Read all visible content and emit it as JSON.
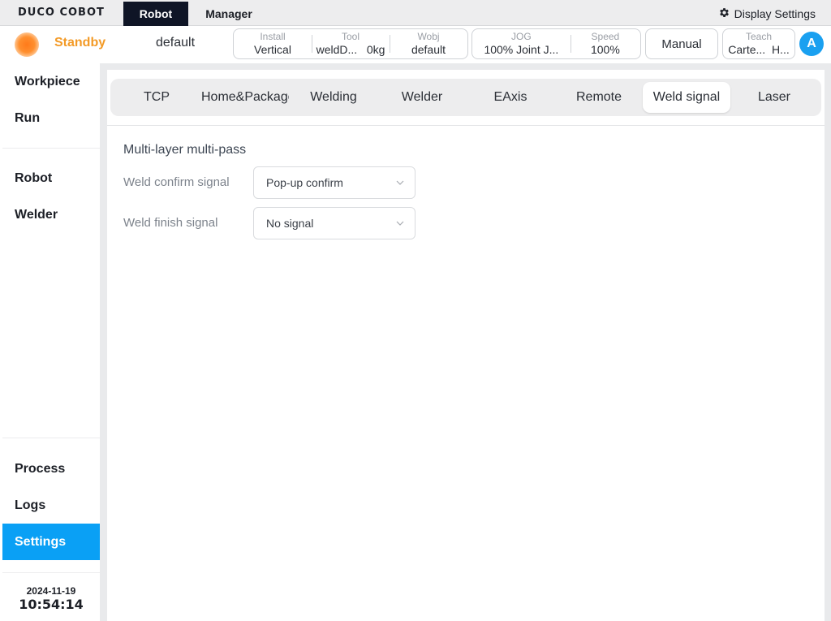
{
  "topbar": {
    "logo": "DUCO COBOT",
    "tabs": [
      {
        "label": "Robot",
        "active": true
      },
      {
        "label": "Manager",
        "active": false
      }
    ],
    "display_settings": "Display Settings",
    "display_settings_icon": "gear-icon"
  },
  "statusbar": {
    "status": "Standby",
    "status_color": "#f39a26",
    "program": "default",
    "install": {
      "label": "Install",
      "value": "Vertical"
    },
    "tool": {
      "label": "Tool",
      "value": "weldD...   0kg"
    },
    "wobj": {
      "label": "Wobj",
      "value": "default"
    },
    "jog": {
      "label": "JOG",
      "value": "100% Joint J..."
    },
    "speed": {
      "label": "Speed",
      "value": "100%"
    },
    "mode": "Manual",
    "teach": {
      "label": "Teach",
      "value": "Carte...  H..."
    },
    "user_initial": "A"
  },
  "sidebar": {
    "top_items": [
      {
        "label": "Workpiece"
      },
      {
        "label": "Run"
      },
      {
        "label": "Robot"
      },
      {
        "label": "Welder"
      }
    ],
    "bottom_items": [
      {
        "label": "Process"
      },
      {
        "label": "Logs"
      },
      {
        "label": "Settings",
        "active": true
      }
    ],
    "date": "2024-11-19",
    "time": "10:54:14",
    "accent": "#0aa0f5"
  },
  "main": {
    "tabs": [
      {
        "label": "TCP"
      },
      {
        "label": "Home&Package"
      },
      {
        "label": "Welding"
      },
      {
        "label": "Welder"
      },
      {
        "label": "EAxis"
      },
      {
        "label": "Remote"
      },
      {
        "label": "Weld signal",
        "active": true
      },
      {
        "label": "Laser"
      }
    ],
    "section_title": "Multi-layer multi-pass",
    "fields": [
      {
        "label": "Weld confirm signal",
        "value": "Pop-up confirm"
      },
      {
        "label": "Weld finish signal",
        "value": "No signal"
      }
    ]
  }
}
